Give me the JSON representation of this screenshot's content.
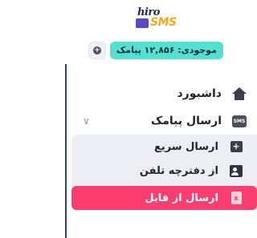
{
  "brand": {
    "logo_top": "hiro",
    "logo_bottom": "SMS"
  },
  "balance": {
    "text": "موجودی: ۱۲,۸۵۶ پیامک",
    "add_icon": "plus-circle-icon",
    "accent_color": "#52e1d1"
  },
  "nav": {
    "dashboard": {
      "label": "داشبورد",
      "icon": "home-icon"
    },
    "send_sms": {
      "label": "ارسال پیامک",
      "icon": "sms-icon",
      "expanded": true
    },
    "submenu": [
      {
        "label": "ارسال سریع",
        "icon": "chat-plus-icon",
        "active": false
      },
      {
        "label": "از دفترچه تلفن",
        "icon": "contacts-icon",
        "active": false
      },
      {
        "label": "ارسال از فایل",
        "icon": "excel-file-icon",
        "active": true
      }
    ]
  },
  "colors": {
    "active_item": "#fb3d6f",
    "submenu_bg": "#eceef3",
    "divider": "#2a3f8f"
  }
}
